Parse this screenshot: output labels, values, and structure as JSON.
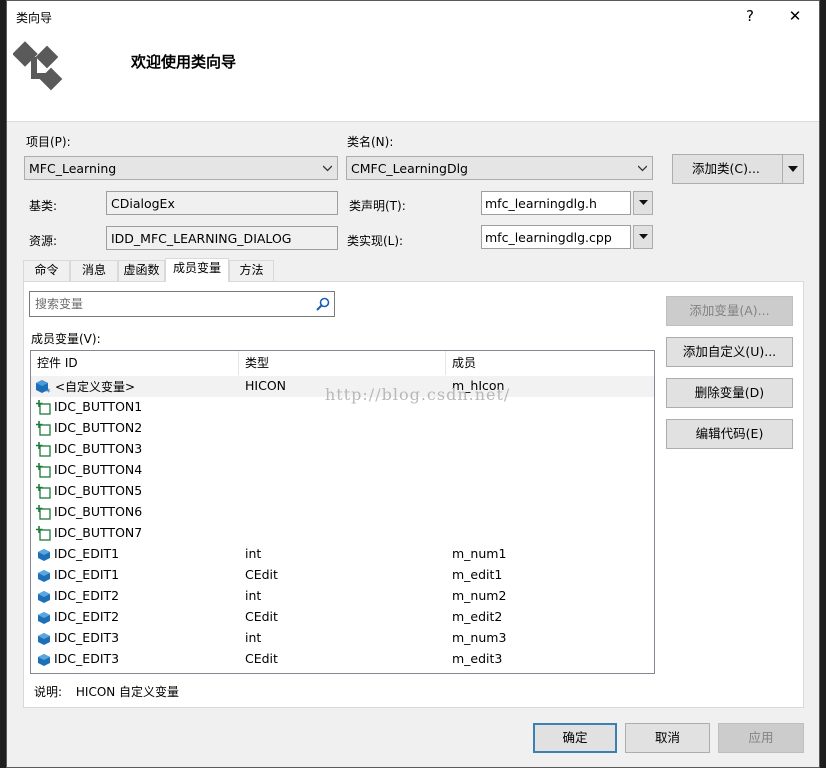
{
  "window": {
    "title": "类向导",
    "help_label": "?",
    "close_label": "✕"
  },
  "header": {
    "title": "欢迎使用类向导"
  },
  "project": {
    "label": "项目(P):",
    "value": "MFC_Learning"
  },
  "classname": {
    "label": "类名(N):",
    "value": "CMFC_LearningDlg"
  },
  "add_class_button": "添加类(C)...",
  "base": {
    "label": "基类:",
    "value": "CDialogEx"
  },
  "resource": {
    "label": "资源:",
    "value": "IDD_MFC_LEARNING_DIALOG"
  },
  "declaration": {
    "label": "类声明(T):",
    "value": "mfc_learningdlg.h"
  },
  "implementation": {
    "label": "类实现(L):",
    "value": "mfc_learningdlg.cpp"
  },
  "tabs": [
    "命令",
    "消息",
    "虚函数",
    "成员变量",
    "方法"
  ],
  "active_tab": "成员变量",
  "search": {
    "placeholder": "搜索变量"
  },
  "members_label": "成员变量(V):",
  "columns": [
    "控件 ID",
    "类型",
    "成员"
  ],
  "rows": [
    {
      "id": "<自定义变量>",
      "type": "HICON",
      "member": "m_hIcon",
      "icon": "custom-variable-icon"
    },
    {
      "id": "IDC_BUTTON1",
      "type": "",
      "member": "",
      "icon": "button-control-icon"
    },
    {
      "id": "IDC_BUTTON2",
      "type": "",
      "member": "",
      "icon": "button-control-icon"
    },
    {
      "id": "IDC_BUTTON3",
      "type": "",
      "member": "",
      "icon": "button-control-icon"
    },
    {
      "id": "IDC_BUTTON4",
      "type": "",
      "member": "",
      "icon": "button-control-icon"
    },
    {
      "id": "IDC_BUTTON5",
      "type": "",
      "member": "",
      "icon": "button-control-icon"
    },
    {
      "id": "IDC_BUTTON6",
      "type": "",
      "member": "",
      "icon": "button-control-icon"
    },
    {
      "id": "IDC_BUTTON7",
      "type": "",
      "member": "",
      "icon": "button-control-icon"
    },
    {
      "id": "IDC_EDIT1",
      "type": "int",
      "member": "m_num1",
      "icon": "variable-icon"
    },
    {
      "id": "IDC_EDIT1",
      "type": "CEdit",
      "member": "m_edit1",
      "icon": "variable-icon"
    },
    {
      "id": "IDC_EDIT2",
      "type": "int",
      "member": "m_num2",
      "icon": "variable-icon"
    },
    {
      "id": "IDC_EDIT2",
      "type": "CEdit",
      "member": "m_edit2",
      "icon": "variable-icon"
    },
    {
      "id": "IDC_EDIT3",
      "type": "int",
      "member": "m_num3",
      "icon": "variable-icon"
    },
    {
      "id": "IDC_EDIT3",
      "type": "CEdit",
      "member": "m_edit3",
      "icon": "variable-icon"
    }
  ],
  "watermark": "http://blog.csdn.net/",
  "side_buttons": {
    "add_variable": "添加变量(A)...",
    "add_custom": "添加自定义(U)...",
    "delete_variable": "删除变量(D)",
    "edit_code": "编辑代码(E)"
  },
  "description": {
    "label": "说明:",
    "text": "HICON 自定义变量"
  },
  "footer": {
    "ok": "确定",
    "cancel": "取消",
    "apply": "应用"
  }
}
